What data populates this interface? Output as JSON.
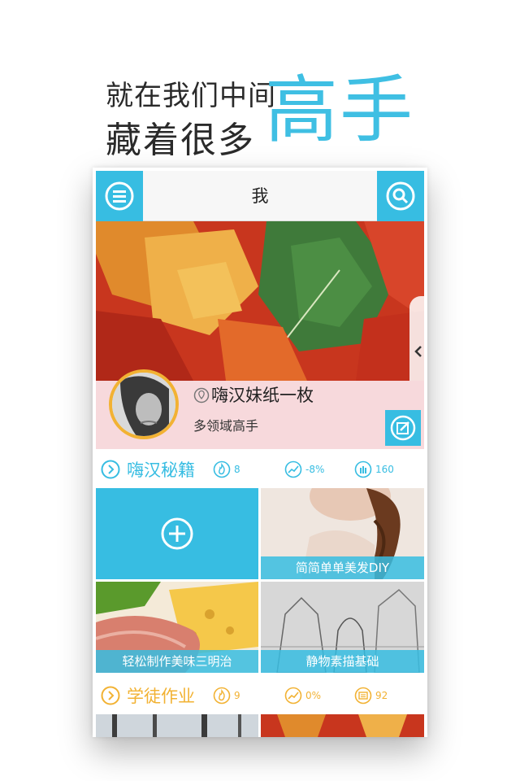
{
  "headline": {
    "line1": "就在我们中间",
    "line2": "藏着很多",
    "accent": "高手"
  },
  "header": {
    "title": "我",
    "menu_icon": "menu-icon",
    "search_icon": "search-icon"
  },
  "profile": {
    "name": "嗨汉妹纸一枚",
    "title": "多领域高手",
    "location_icon": "location-pin-icon",
    "edit_icon": "edit-icon"
  },
  "section_secrets": {
    "label": "嗨汉秘籍",
    "stats": [
      {
        "icon": "flame-icon",
        "value": "8"
      },
      {
        "icon": "trend-icon",
        "value": "-8%"
      },
      {
        "icon": "people-icon",
        "value": "160"
      }
    ]
  },
  "tiles_secrets": [
    {
      "caption": "简简单单美发DIY"
    },
    {
      "caption": "轻松制作美味三明治"
    },
    {
      "caption": "静物素描基础"
    }
  ],
  "section_homework": {
    "label": "学徒作业",
    "stats": [
      {
        "icon": "flame-icon",
        "value": "9"
      },
      {
        "icon": "trend-icon",
        "value": "0%"
      },
      {
        "icon": "score-icon",
        "value": "92"
      }
    ]
  },
  "colors": {
    "accent_blue": "#37bde2",
    "accent_orange": "#f2b233",
    "stat_blue": "#3a9fd8"
  }
}
